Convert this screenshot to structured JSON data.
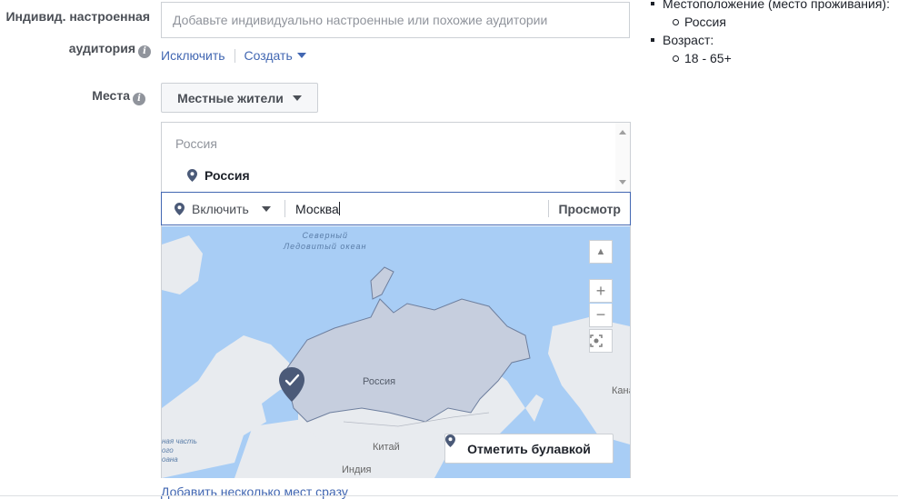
{
  "custom_audience": {
    "label_line1": "Индивид. настроенная",
    "label_line2": "аудитория",
    "placeholder": "Добавьте индивидуально настроенные или похожие аудитории",
    "exclude_link": "Исключить",
    "create_link": "Создать"
  },
  "places": {
    "label": "Места",
    "type_button": "Местные жители",
    "group_header": "Россия",
    "selected_location": "Россия",
    "include_dropdown": "Включить",
    "search_value": "Москва",
    "preview_button": "Просмотр"
  },
  "map": {
    "ocean_label_line1": "Северный",
    "ocean_label_line2": "Ледовитый океан",
    "country_label": "Россия",
    "china_label": "Китай",
    "india_label": "Индия",
    "canada_label": "Кана",
    "left_label_line1": "ная часть",
    "left_label_line2": "ого",
    "left_label_line3": "оана",
    "collapse_icon": "chevron-up-icon",
    "zoom_in_label": "+",
    "zoom_out_label": "−",
    "mark_pin_button": "Отметить булавкой",
    "colors": {
      "water": "#a8cdf5",
      "land": "#e8ebef",
      "selected_region": "#c6cede",
      "accent": "#4267b2"
    }
  },
  "add_multiple_link": "Добавить несколько мест сразу",
  "summary": {
    "location_line": "Местоположение (место проживания):",
    "location_value": "Россия",
    "age_line": "Возраст:",
    "age_value": "18 - 65+"
  }
}
